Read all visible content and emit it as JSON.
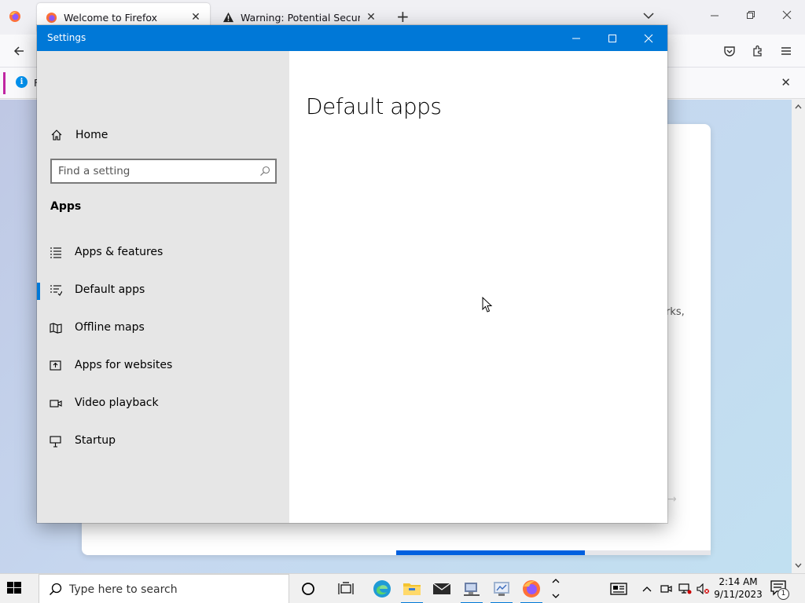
{
  "firefox": {
    "tabs": [
      {
        "title": "Welcome to Firefox",
        "close": "✕"
      },
      {
        "title": "Warning: Potential Security Risk Ahead",
        "close": "✕"
      }
    ],
    "new_tab": "+",
    "notification": {
      "visible_text": "F",
      "close": "✕"
    },
    "welcome_card": {
      "partial_text": "arks,",
      "progress_fraction": 0.6
    }
  },
  "settings_window": {
    "title": "Settings",
    "nav": {
      "home_label": "Home",
      "search_placeholder": "Find a setting",
      "section_label": "Apps",
      "items": [
        {
          "label": "Apps & features",
          "icon": "apps-features-icon",
          "selected": false
        },
        {
          "label": "Default apps",
          "icon": "default-apps-icon",
          "selected": true
        },
        {
          "label": "Offline maps",
          "icon": "offline-maps-icon",
          "selected": false
        },
        {
          "label": "Apps for websites",
          "icon": "apps-for-websites-icon",
          "selected": false
        },
        {
          "label": "Video playback",
          "icon": "video-playback-icon",
          "selected": false
        },
        {
          "label": "Startup",
          "icon": "startup-icon",
          "selected": false
        }
      ]
    },
    "content": {
      "page_title": "Default apps"
    }
  },
  "taskbar": {
    "search_placeholder": "Type here to search",
    "clock": {
      "time": "2:14 AM",
      "date": "9/11/2023"
    },
    "notification_count": "1"
  },
  "colors": {
    "accent": "#0078d7",
    "nav_bg": "#e6e6e6",
    "firefox_progress": "#0060df"
  }
}
